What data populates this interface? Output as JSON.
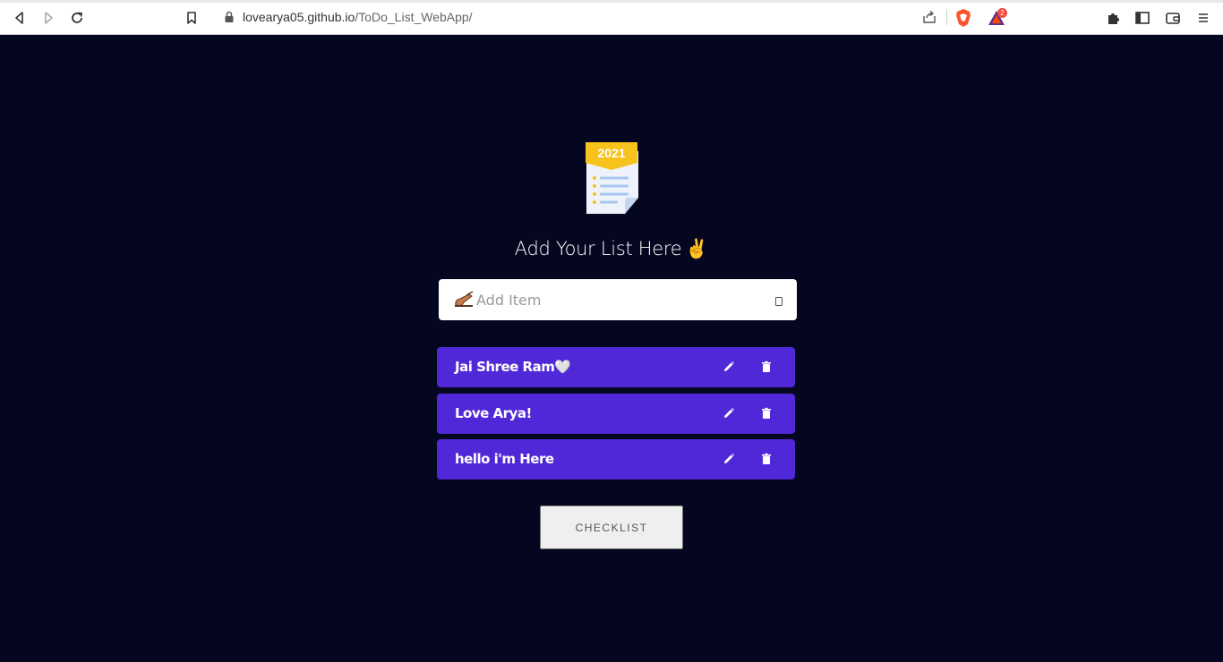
{
  "browser": {
    "url_host": "lovearya05.github.io",
    "url_path": "/ToDo_List_WebApp/",
    "rewards_badge": "2"
  },
  "app": {
    "logo_year": "2021",
    "heading": "Add Your List Here",
    "heading_emoji": "✌",
    "input": {
      "placeholder": "Add Item",
      "value": ""
    },
    "items": [
      {
        "label": "Jai Shree Ram🤍"
      },
      {
        "label": "Love Arya!"
      },
      {
        "label": "hello i'm Here"
      }
    ],
    "checklist_button": "CHECKLIST"
  },
  "colors": {
    "background": "#05061f",
    "item": "#5128d8",
    "button": "#efefef"
  },
  "icons": {
    "back": "back-arrow-icon",
    "forward": "forward-arrow-icon",
    "reload": "reload-icon",
    "bookmark": "bookmark-icon",
    "lock": "lock-icon",
    "share": "share-icon",
    "brave": "brave-shield-icon",
    "rewards": "brave-rewards-icon",
    "extensions": "puzzle-icon",
    "sidebar": "sidebar-icon",
    "wallet": "wallet-icon",
    "menu": "hamburger-menu-icon",
    "edit": "pencil-icon",
    "delete": "trash-icon"
  }
}
